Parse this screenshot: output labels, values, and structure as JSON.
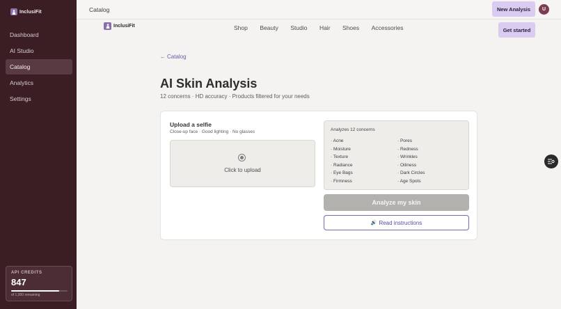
{
  "sidebar": {
    "brand": "InclusiFit",
    "items": [
      {
        "label": "Dashboard"
      },
      {
        "label": "AI Studio"
      },
      {
        "label": "Catalog",
        "active": true
      },
      {
        "label": "Analytics"
      },
      {
        "label": "Settings"
      }
    ],
    "credits": {
      "label": "API CREDITS",
      "value": "847",
      "remaining_text": "of 1,000 remaining",
      "used_fraction": 0.847
    }
  },
  "topbar": {
    "title": "Catalog",
    "new_analysis_label": "New Analysis",
    "avatar_initial": "U"
  },
  "site_header": {
    "brand": "InclusiFit",
    "nav": [
      "Shop",
      "Beauty",
      "Studio",
      "Hair",
      "Shoes",
      "Accessories"
    ],
    "cta_label": "Get started"
  },
  "page": {
    "back_label": "Catalog",
    "title": "AI Skin Analysis",
    "subtitle": "12 concerns · HD accuracy · Products filtered for your needs"
  },
  "upload": {
    "title": "Upload a selfie",
    "hint": "Close-up face · Good lighting · No glasses",
    "dropzone_text": "Click to upload"
  },
  "concerns": {
    "title": "Analyzes 12 concerns",
    "left": [
      "· Acne",
      "· Moisture",
      "· Texture",
      "· Radiance",
      "· Eye Bags",
      "· Firmness"
    ],
    "right": [
      "· Pores",
      "· Redness",
      "· Wrinkles",
      "· Oiliness",
      "· Dark Circles",
      "· Age Spots"
    ]
  },
  "actions": {
    "analyze_label": "Analyze my skin",
    "instructions_label": "Read instructions",
    "instructions_icon": "🔊"
  },
  "colors": {
    "sidebar_bg": "#3b1d24",
    "accent": "#d9ccf0",
    "link": "#6b5aa0"
  }
}
